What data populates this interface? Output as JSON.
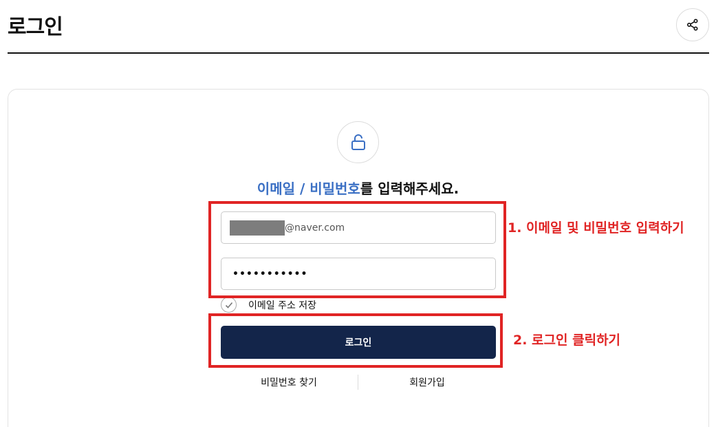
{
  "header": {
    "title": "로그인",
    "share_icon": "share-icon"
  },
  "card": {
    "lock_icon": "unlock-icon",
    "headline_accent": "이메일 / 비밀번호",
    "headline_rest": "를 입력해주세요."
  },
  "form": {
    "email_value_visible": "@naver.com",
    "email_redacted": true,
    "password_value": "•••••••••••",
    "remember_label": "이메일 주소 저장",
    "remember_checked": true,
    "login_label": "로그인"
  },
  "links": {
    "find_password": "비밀번호 찾기",
    "signup": "회원가입"
  },
  "annotations": {
    "step1": "1. 이메일 및 비밀번호 입력하기",
    "step2": "2. 로그인 클릭하기",
    "color": "#e02424"
  },
  "colors": {
    "accent": "#3a6fc4",
    "button_bg": "#13254a"
  }
}
